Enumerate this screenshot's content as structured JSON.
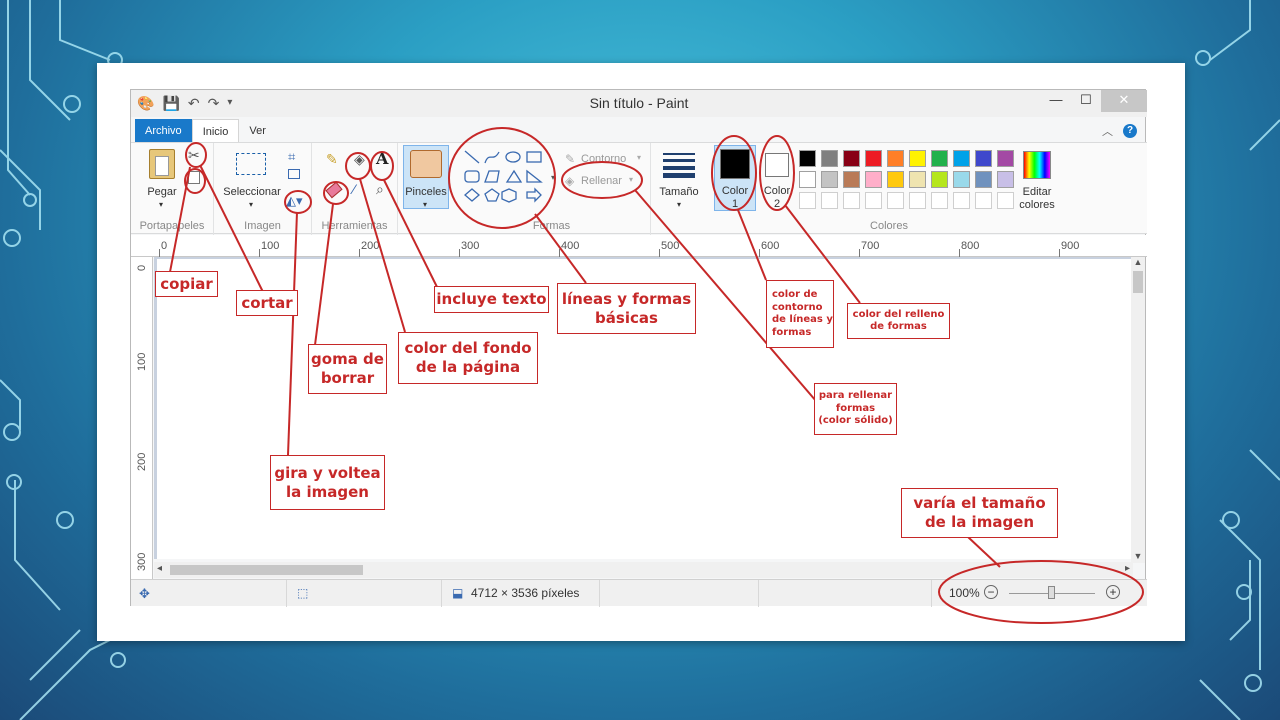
{
  "window": {
    "title": "Sin título - Paint"
  },
  "tabs": [
    "Archivo",
    "Inicio",
    "Ver"
  ],
  "ribbon": {
    "paste_label": "Pegar",
    "select_label": "Seleccionar",
    "brushes_label": "Pinceles",
    "outline_label": "Contorno",
    "fill_label": "Rellenar",
    "size_label": "Tamaño",
    "color1_label": "Color\n1",
    "color2_label": "Color\n2",
    "edit_colors_label": "Editar\ncolores",
    "groups": [
      "Portapapeles",
      "Imagen",
      "Herramientas",
      "Formas",
      "Colores"
    ],
    "color1": "#000000",
    "color2": "#ffffff",
    "palette_row1": [
      "#000000",
      "#7f7f7f",
      "#880015",
      "#ed1c24",
      "#ff7f27",
      "#fff200",
      "#22b14c",
      "#00a2e8",
      "#3f48cc",
      "#a349a4"
    ],
    "palette_row2": [
      "#ffffff",
      "#c3c3c3",
      "#b97a57",
      "#ffaec9",
      "#ffc90e",
      "#efe4b0",
      "#b5e61d",
      "#99d9ea",
      "#7092be",
      "#c8bfe7"
    ]
  },
  "rulers": {
    "h": [
      "0",
      "100",
      "200",
      "300",
      "400",
      "500",
      "600",
      "700",
      "800",
      "900"
    ],
    "v": [
      "0",
      "100",
      "200",
      "300"
    ]
  },
  "status": {
    "dimensions": "4712 × 3536 píxeles",
    "zoom": "100%"
  },
  "annotations": {
    "copiar": "copiar",
    "cortar": "cortar",
    "incluye_texto": "incluye texto",
    "lineas_formas": "líneas y formas\nbásicas",
    "goma": "goma de\nborrar",
    "fondo": "color del fondo\nde la página",
    "gira": "gira y voltea\nla imagen",
    "contorno": "color de\ncontorno\nde líneas y\nformas",
    "relleno_formas": "color del relleno\nde formas",
    "rellenar": "para rellenar\nformas\n(color sólido)",
    "tamano": "varía el tamaño\nde la imagen"
  }
}
